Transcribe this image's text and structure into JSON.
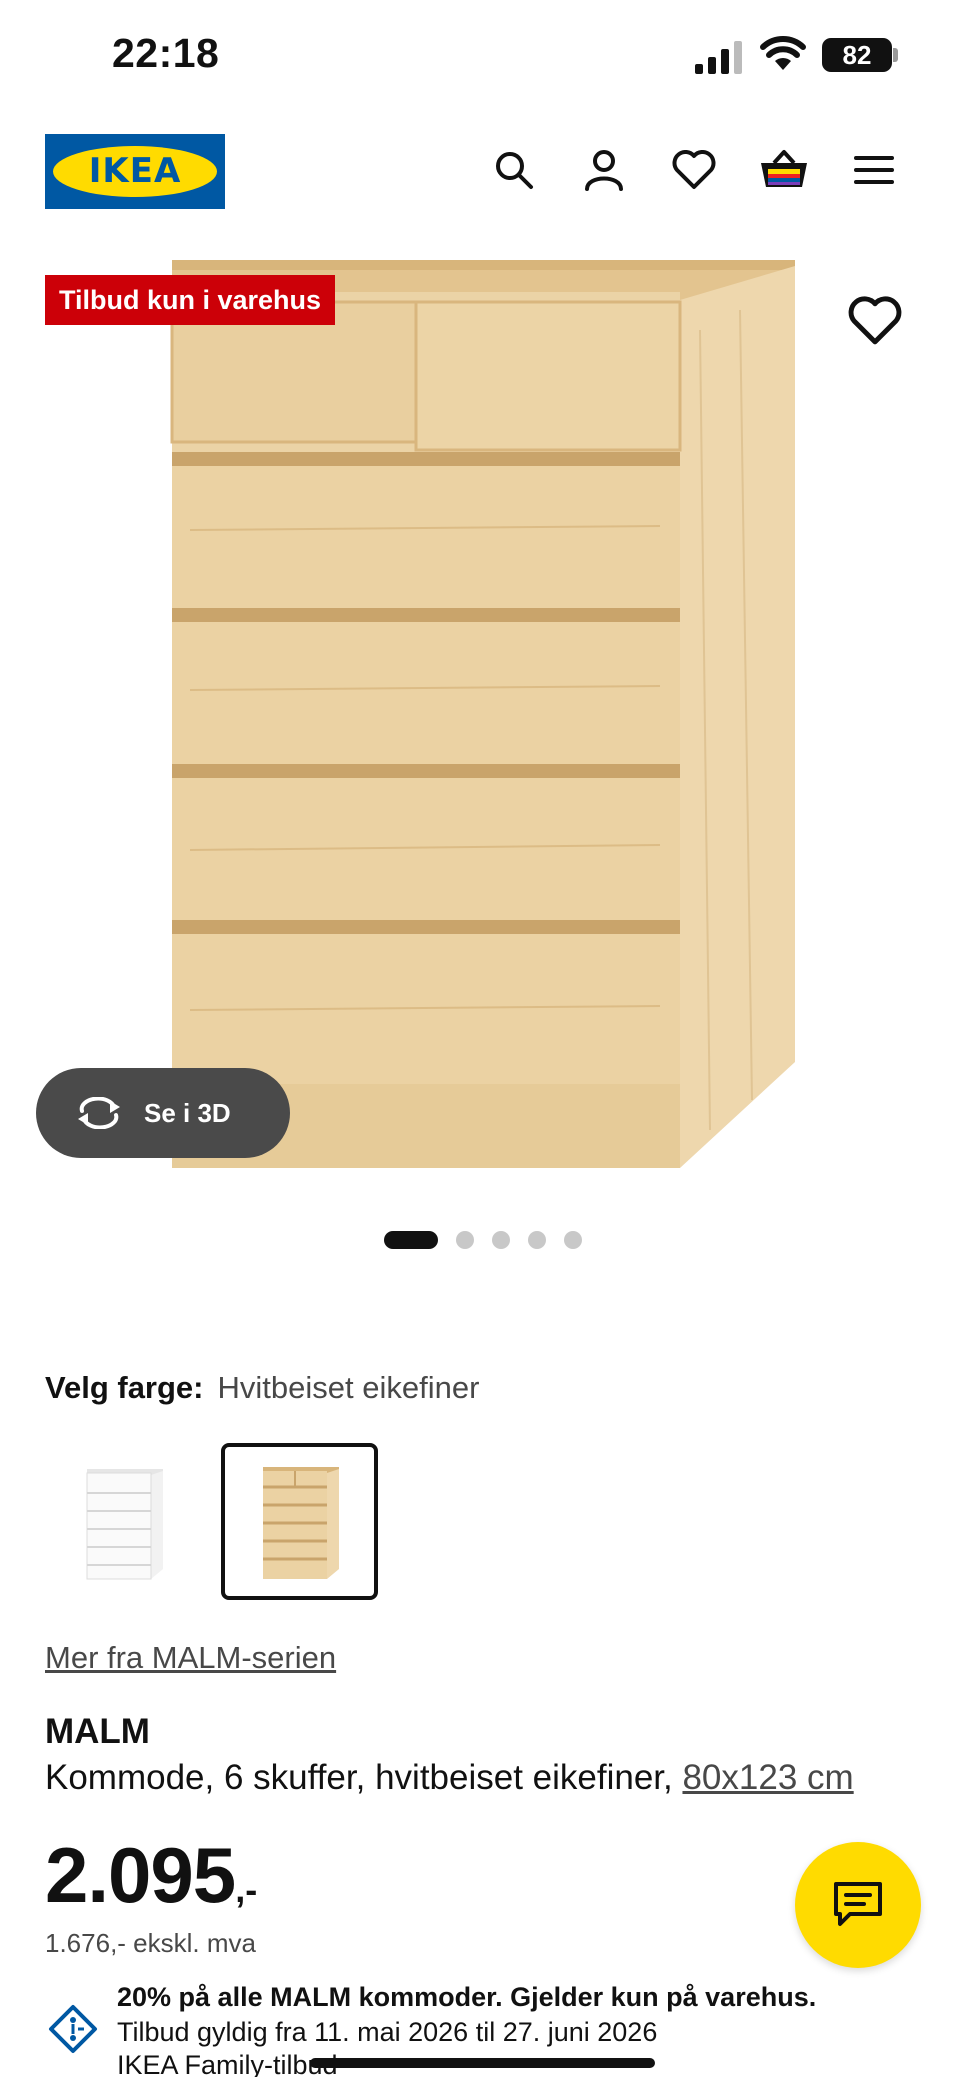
{
  "status_bar": {
    "time": "22:18",
    "battery": "82"
  },
  "header": {
    "logo_text": "IKEA",
    "icons": [
      "search-icon",
      "account-icon",
      "heart-icon",
      "cart-icon",
      "menu-icon"
    ]
  },
  "gallery": {
    "badge": "Tilbud kun i varehus",
    "view_3d_label": "Se i 3D",
    "image_count": 5,
    "active_image": 1
  },
  "color": {
    "label": "Velg farge:",
    "value": "Hvitbeiset eikefiner",
    "swatches": [
      "Hvit",
      "Hvitbeiset eikefiner"
    ],
    "selected_index": 1
  },
  "series_link": "Mer fra MALM-serien",
  "product": {
    "name": "MALM",
    "description": "Kommode, 6 skuffer, hvitbeiset eikefiner, ",
    "size": "80x123 cm"
  },
  "price": {
    "main": "2.095",
    "suffix": ",-",
    "ex_vat": "1.676,- ekskl. mva"
  },
  "offer": {
    "title": "20% på alle MALM kommoder. Gjelder kun på varehus.",
    "valid": "Tilbud gyldig fra 11. mai 2026 til 27. juni 2026",
    "family": "IKEA Family-tilbud"
  },
  "colors": {
    "ikea_blue": "#0058a3",
    "ikea_yellow": "#ffdb00",
    "badge_red": "#cc0008",
    "wood": "#e8cc9a"
  }
}
